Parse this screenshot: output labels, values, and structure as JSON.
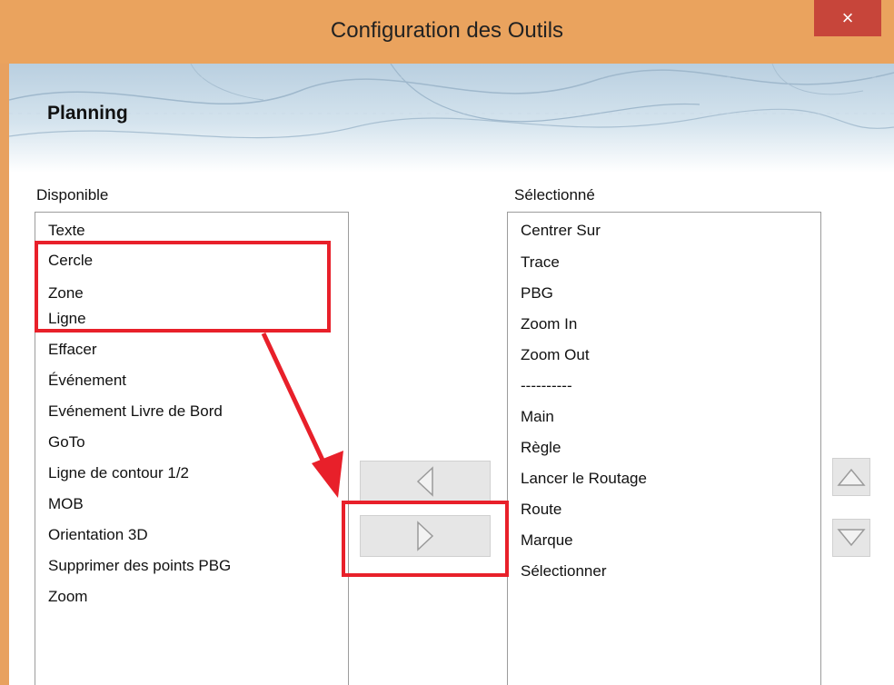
{
  "window": {
    "title": "Configuration des Outils",
    "close_label": "×"
  },
  "banner": {
    "title": "Planning"
  },
  "available": {
    "label": "Disponible",
    "items": [
      "Texte",
      "Cercle",
      "Zone",
      "Ligne",
      "Effacer",
      "Événement",
      "Evénement Livre de Bord",
      "GoTo",
      "Ligne de contour 1/2",
      "MOB",
      "Orientation 3D",
      "Supprimer des points PBG",
      "Zoom"
    ]
  },
  "selected": {
    "label": "Sélectionné",
    "items": [
      "Centrer Sur",
      "Trace",
      "PBG",
      "Zoom In",
      "Zoom Out",
      "----------",
      "Main",
      "Règle",
      "Lancer le Routage",
      "Route",
      "Marque",
      "Sélectionner"
    ]
  },
  "colors": {
    "titlebar": "#eaa35e",
    "close_button": "#c7453a",
    "annotation": "#e8202a"
  },
  "icons": {
    "move_left": "triangle-left-icon",
    "move_right": "triangle-right-icon",
    "move_up": "triangle-up-icon",
    "move_down": "triangle-down-icon"
  }
}
